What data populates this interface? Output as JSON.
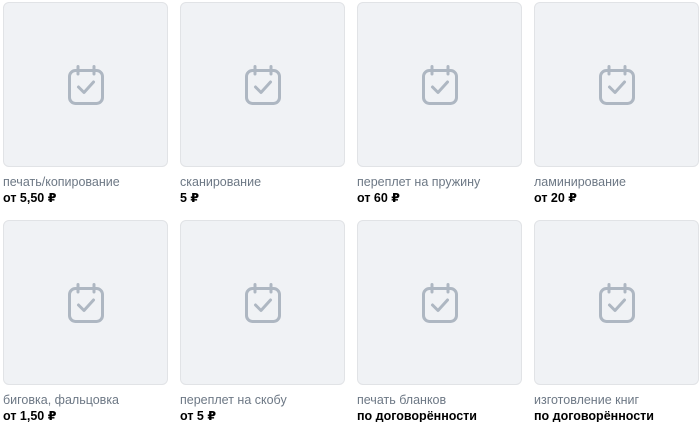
{
  "colors": {
    "placeholder_bg": "#f0f2f5",
    "placeholder_icon": "#aeb7c2",
    "name_text": "#6d7885",
    "price_text": "#000000"
  },
  "products": [
    {
      "name": "печать/копирование",
      "price": "от 5,50 ₽",
      "icon": "calendar-check-icon"
    },
    {
      "name": "сканирование",
      "price": "5 ₽",
      "icon": "calendar-check-icon"
    },
    {
      "name": "переплет на пружину",
      "price": "от 60 ₽",
      "icon": "calendar-check-icon"
    },
    {
      "name": "ламинирование",
      "price": "от 20 ₽",
      "icon": "calendar-check-icon"
    },
    {
      "name": "биговка, фальцовка",
      "price": "от 1,50 ₽",
      "icon": "calendar-check-icon"
    },
    {
      "name": "переплет на скобу",
      "price": "от 5 ₽",
      "icon": "calendar-check-icon"
    },
    {
      "name": "печать бланков",
      "price": "по договорённости",
      "icon": "calendar-check-icon"
    },
    {
      "name": "изготовление книг",
      "price": "по договорённости",
      "icon": "calendar-check-icon"
    }
  ]
}
